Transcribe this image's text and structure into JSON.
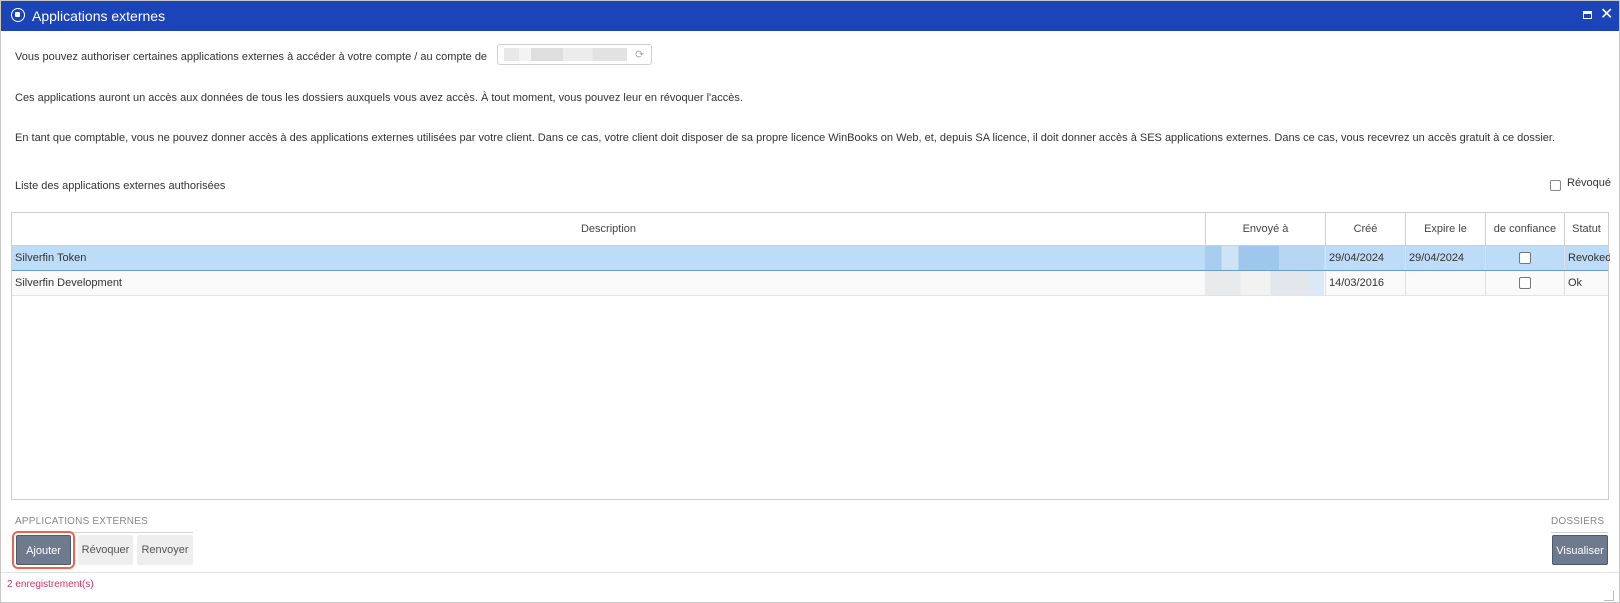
{
  "window": {
    "title": "Applications externes",
    "accent": "#1b44b8"
  },
  "intro": {
    "line1": "Vous pouvez authoriser certaines applications externes à accéder à votre compte / au compte de",
    "line2": "Ces applications auront un accès aux données de tous les dossiers auxquels vous avez accès. À tout moment, vous pouvez leur en révoquer l'accès.",
    "line3": "En tant que comptable, vous ne pouvez donner accès à des applications externes utilisées par votre client. Dans ce cas, votre client doit disposer de sa propre licence WinBooks on Web, et, depuis SA licence, il doit donner accès à SES applications externes. Dans ce cas, vous recevrez un accès gratuit à ce dossier."
  },
  "list": {
    "title": "Liste des applications externes authorisées",
    "revoked_filter_label": "Révoqué"
  },
  "table": {
    "columns": [
      "Description",
      "Envoyé à",
      "Créé",
      "Expire le",
      "de confiance",
      "Statut"
    ],
    "rows": [
      {
        "description": "Silverfin Token",
        "sent_to": "",
        "created": "29/04/2024",
        "expires": "29/04/2024",
        "trusted": false,
        "status": "Revoked",
        "selected": true
      },
      {
        "description": "Silverfin Development",
        "sent_to": "",
        "created": "14/03/2016",
        "expires": "",
        "trusted": false,
        "status": "Ok",
        "selected": false
      }
    ]
  },
  "actions": {
    "section_label": "APPLICATIONS EXTERNES",
    "add": "Ajouter",
    "revoke": "Révoquer",
    "resend": "Renvoyer"
  },
  "dossiers": {
    "section_label": "DOSSIERS",
    "view": "Visualiser"
  },
  "footer": {
    "count": "2 enregistrement(s)",
    "count_color": "#d6336c"
  }
}
